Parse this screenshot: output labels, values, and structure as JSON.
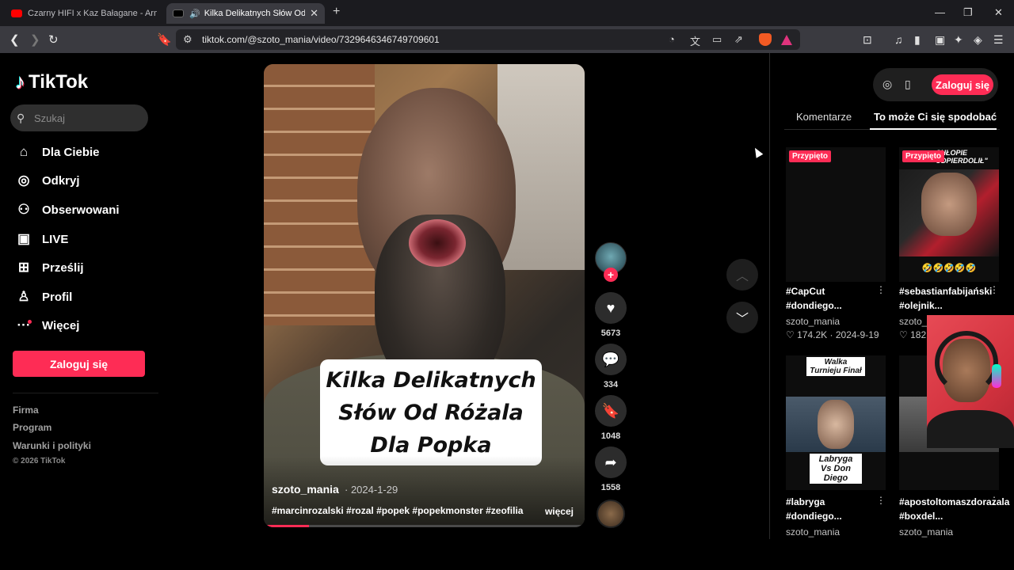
{
  "browser": {
    "tabs": [
      {
        "label": "Czarny HIFI x Kaz Bałagane - Armani",
        "favicon_color": "#ff0000",
        "active": false
      },
      {
        "label": "Kilka Delikatnych Słów Od Ró",
        "favicon_color": "#000000",
        "active": true
      }
    ],
    "new_tab_label": "+",
    "url": "tiktok.com/@szoto_mania/video/7329646346749709601"
  },
  "sidebar": {
    "logo": "TikTok",
    "search_placeholder": "Szukaj",
    "items": [
      {
        "label": "Dla Ciebie",
        "icon": "home-icon"
      },
      {
        "label": "Odkryj",
        "icon": "compass-icon"
      },
      {
        "label": "Obserwowani",
        "icon": "following-icon"
      },
      {
        "label": "LIVE",
        "icon": "live-icon"
      },
      {
        "label": "Prześlij",
        "icon": "upload-icon"
      },
      {
        "label": "Profil",
        "icon": "profile-icon"
      },
      {
        "label": "Więcej",
        "icon": "more-icon"
      }
    ],
    "login": "Zaloguj się",
    "footer_links": [
      "Firma",
      "Program",
      "Warunki i polityki"
    ],
    "copyright": "© 2026 TikTok"
  },
  "video": {
    "caption_lines": [
      "Kilka Delikatnych",
      "Słów Od Różala",
      "Dla Popka"
    ],
    "author": "szoto_mania",
    "date": "· 2024-1-29",
    "hashtags": "#marcinrozalski #rozal #popek #popekmonster #zeofilia",
    "more": "więcej",
    "progress": 0.14
  },
  "actions": {
    "likes": "5673",
    "comments": "334",
    "saves": "1048",
    "shares": "1558"
  },
  "right_panel": {
    "login": "Zaloguj się",
    "tabs": [
      "Komentarze",
      "To może Ci się spodobać"
    ],
    "pinned_label": "Przypięto",
    "videos": [
      {
        "title": "#CapCut #dondiego...",
        "user": "szoto_mania",
        "likes": "174.2K",
        "date": "2024-9-19",
        "pinned": true
      },
      {
        "title": "#sebastianfabijański #olejnik...",
        "user": "szoto_m",
        "likes": "182",
        "date": "",
        "pinned": true,
        "overlay": "CHŁOPIE ODPIERDOLIŁ\"",
        "emoji": "🤣🤣🤣🤣🤣"
      },
      {
        "title": "#labryga #dondiego...",
        "user": "szoto_mania",
        "overlay_top": "Walka Turnieju Finał",
        "overlay_bottom": "Labryga Vs Don Diego"
      },
      {
        "title": "#apostoltomaszdorazala #boxdel...",
        "user": "szoto_mania"
      }
    ]
  }
}
